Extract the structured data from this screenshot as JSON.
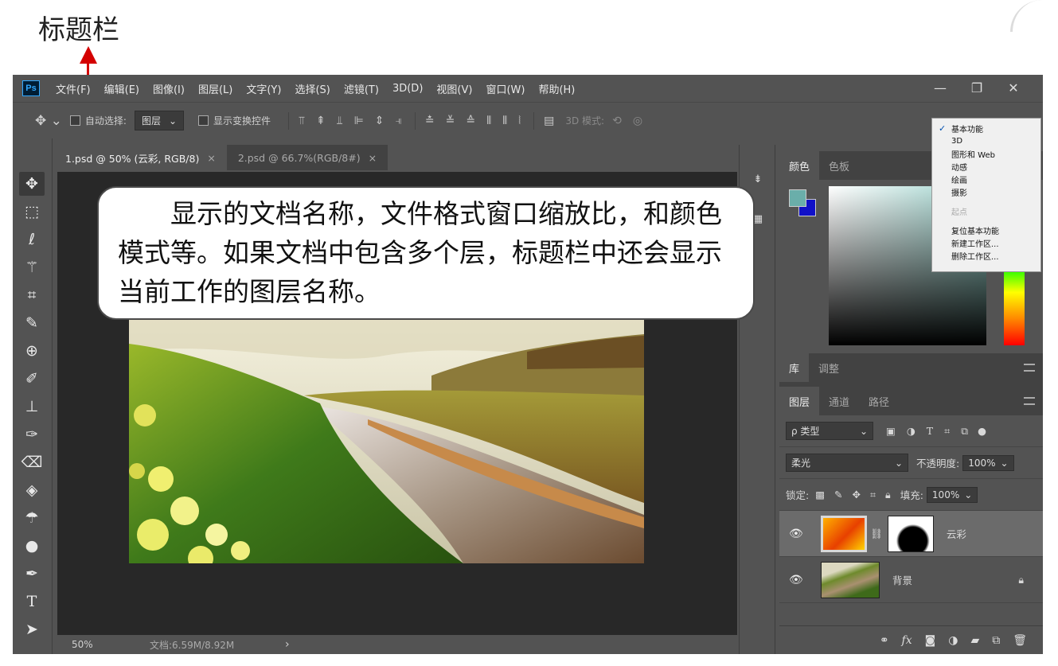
{
  "annotation": {
    "title": "标题栏"
  },
  "callout": {
    "text": "显示的文档名称，文件格式窗口缩放比，和颜色模式等。如果文档中包含多个层，标题栏中还会显示当前工作的图层名称。"
  },
  "menubar": {
    "logo": "Ps",
    "items": [
      "文件(F)",
      "编辑(E)",
      "图像(I)",
      "图层(L)",
      "文字(Y)",
      "选择(S)",
      "滤镜(T)",
      "3D(D)",
      "视图(V)",
      "窗口(W)",
      "帮助(H)"
    ]
  },
  "options": {
    "auto_select": "自动选择:",
    "layer_select": "图层",
    "show_transform": "显示变换控件",
    "mode3d": "3D 模式:"
  },
  "tabs": [
    {
      "label": "1.psd @ 50% (云彩, RGB/8)",
      "close": "×"
    },
    {
      "label": "2.psd @ 66.7%(RGB/8#)",
      "close": "×"
    }
  ],
  "status": {
    "zoom": "50%",
    "doc": "文档:6.59M/8.92M",
    "arrow": "›"
  },
  "color_panel": {
    "tabs": [
      "颜色",
      "色板"
    ],
    "fg": "#6aaeaa",
    "bg": "#1010c8"
  },
  "library_panel": {
    "tabs": [
      "库",
      "调整"
    ]
  },
  "layers_panel": {
    "tabs": [
      "图层",
      "通道",
      "路径"
    ],
    "filter": "ρ 类型",
    "blend_mode": "柔光",
    "opacity_label": "不透明度:",
    "opacity": "100%",
    "lock_label": "锁定:",
    "fill_label": "填充:",
    "fill": "100%",
    "layers": [
      {
        "name": "云彩",
        "selected": true
      },
      {
        "name": "背景",
        "selected": false
      }
    ]
  },
  "workspace_menu": {
    "items": [
      "基本功能",
      "3D",
      "图形和 Web",
      "动感",
      "绘画",
      "摄影",
      "起点",
      "复位基本功能",
      "新建工作区...",
      "删除工作区..."
    ]
  }
}
